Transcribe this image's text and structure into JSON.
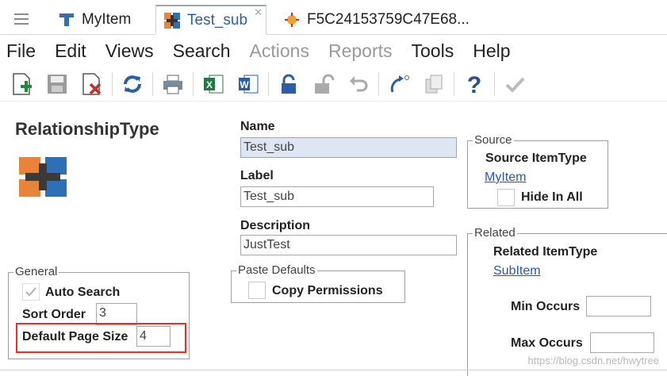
{
  "tabs": [
    {
      "label": "MyItem"
    },
    {
      "label": "Test_sub"
    },
    {
      "label": "F5C24153759C47E68..."
    }
  ],
  "menu": [
    "File",
    "Edit",
    "Views",
    "Search",
    "Actions",
    "Reports",
    "Tools",
    "Help"
  ],
  "toolbar_icons": [
    "new-icon",
    "save-icon",
    "delete-icon",
    "refresh-icon",
    "print-icon",
    "excel-icon",
    "word-icon",
    "lock-icon",
    "unlock-icon",
    "undo-icon",
    "promote-icon",
    "copy-icon",
    "help-icon",
    "done-icon"
  ],
  "main": {
    "title": "RelationshipType"
  },
  "form": {
    "name_label": "Name",
    "name_value": "Test_sub",
    "label_label": "Label",
    "label_value": "Test_sub",
    "description_label": "Description",
    "description_value": "JustTest"
  },
  "source": {
    "legend": "Source",
    "itemtype_label": "Source ItemType",
    "itemtype_link": "MyItem",
    "hide_in_all": "Hide In All"
  },
  "related": {
    "legend": "Related",
    "itemtype_label": "Related ItemType",
    "itemtype_link": "SubItem",
    "min_occurs": "Min Occurs",
    "min_value": "",
    "max_occurs": "Max Occurs",
    "max_value": ""
  },
  "general": {
    "legend": "General",
    "auto_search": "Auto Search",
    "sort_order_label": "Sort Order",
    "sort_order_value": "3",
    "page_size_label": "Default Page Size",
    "page_size_value": "4"
  },
  "paste_defaults": {
    "legend": "Paste Defaults",
    "copy_permissions": "Copy Permissions"
  },
  "watermark": "https://blog.csdn.net/hwytree",
  "colors": {
    "accent_blue": "#2a5fa8",
    "icon_orange": "#e8833a",
    "icon_blue": "#2f6fb8",
    "highlight_red": "#e03030"
  }
}
